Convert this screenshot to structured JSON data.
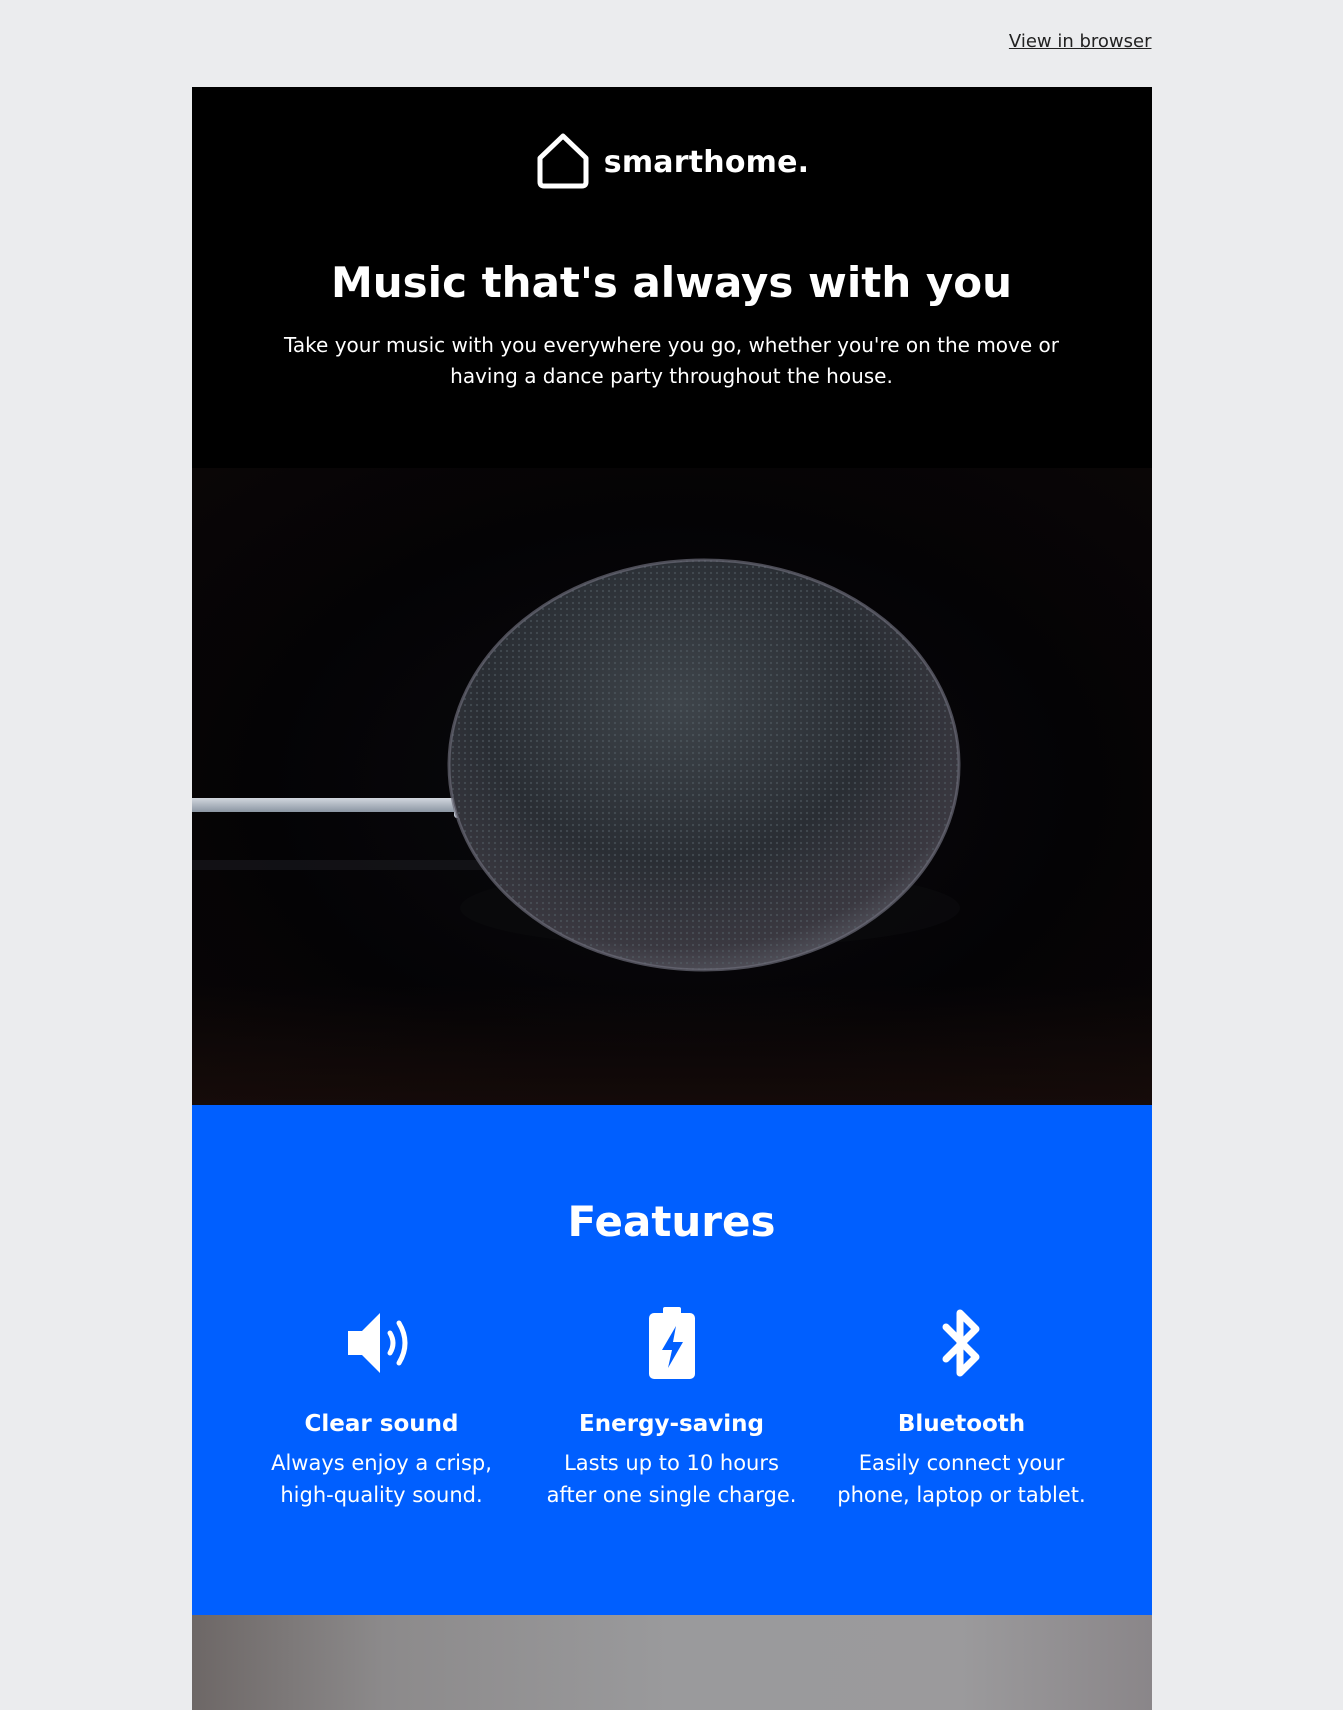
{
  "header": {
    "view_in_browser": "View in browser"
  },
  "brand": {
    "name": "smarthome.",
    "logo_icon": "house-icon"
  },
  "hero": {
    "title": "Music that's always with you",
    "subtitle": "Take your music with you everywhere you go, whether you're on the move or having a dance party throughout the house.",
    "image_icon": "smart-speaker-photo"
  },
  "features": {
    "heading": "Features",
    "items": [
      {
        "icon": "speaker-volume-icon",
        "title": "Clear sound",
        "description": "Always enjoy a crisp, high-quality sound."
      },
      {
        "icon": "battery-charge-icon",
        "title": "Energy-saving",
        "description": "Lasts up to 10 hours after one single charge."
      },
      {
        "icon": "bluetooth-icon",
        "title": "Bluetooth",
        "description": "Easily connect your phone, laptop or tablet."
      }
    ]
  },
  "colors": {
    "page_background": "#ebecee",
    "hero_background": "#000000",
    "features_background": "#005fff",
    "text_light": "#ffffff"
  }
}
